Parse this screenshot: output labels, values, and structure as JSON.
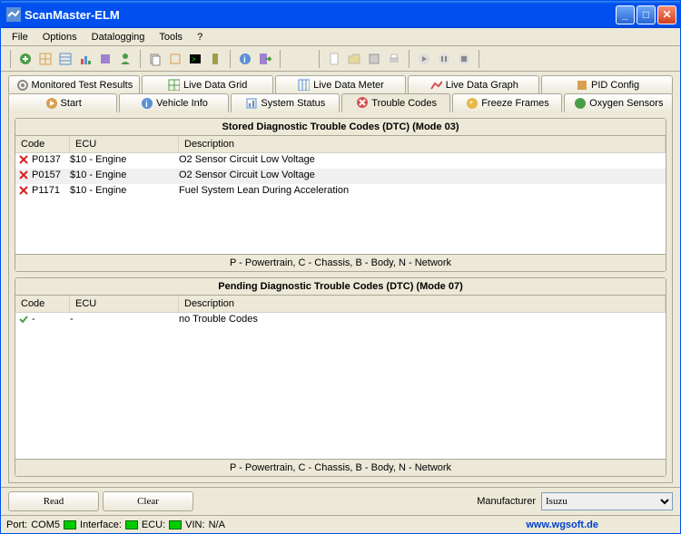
{
  "title": "ScanMaster-ELM",
  "menu": [
    "File",
    "Options",
    "Datalogging",
    "Tools",
    "?"
  ],
  "tabs_row1": [
    {
      "label": "Monitored Test Results",
      "icon": "gear"
    },
    {
      "label": "Live Data Grid",
      "icon": "grid-green"
    },
    {
      "label": "Live Data Meter",
      "icon": "meter"
    },
    {
      "label": "Live Data Graph",
      "icon": "graph"
    },
    {
      "label": "PID Config",
      "icon": "pid"
    }
  ],
  "tabs_row2": [
    {
      "label": "Start",
      "icon": "start"
    },
    {
      "label": "Vehicle Info",
      "icon": "info"
    },
    {
      "label": "System Status",
      "icon": "status"
    },
    {
      "label": "Trouble Codes",
      "icon": "error",
      "active": true
    },
    {
      "label": "Freeze Frames",
      "icon": "freeze"
    },
    {
      "label": "Oxygen Sensors",
      "icon": "o2"
    }
  ],
  "stored": {
    "title": "Stored Diagnostic Trouble Codes (DTC) (Mode 03)",
    "cols": [
      "Code",
      "ECU",
      "Description"
    ],
    "rows": [
      {
        "code": "P0137",
        "ecu": "$10 - Engine",
        "desc": "O2 Sensor Circuit Low Voltage"
      },
      {
        "code": "P0157",
        "ecu": "$10 - Engine",
        "desc": "O2 Sensor Circuit Low Voltage"
      },
      {
        "code": "P1171",
        "ecu": "$10 - Engine",
        "desc": "Fuel System Lean During Acceleration"
      }
    ],
    "footer": "P - Powertrain, C - Chassis, B - Body, N - Network"
  },
  "pending": {
    "title": "Pending Diagnostic Trouble Codes (DTC) (Mode 07)",
    "cols": [
      "Code",
      "ECU",
      "Description"
    ],
    "rows": [
      {
        "code": "-",
        "ecu": "-",
        "desc": "no Trouble Codes",
        "ok": true
      }
    ],
    "footer": "P - Powertrain, C - Chassis, B - Body, N - Network"
  },
  "buttons": {
    "read": "Read",
    "clear": "Clear"
  },
  "manufacturer": {
    "label": "Manufacturer",
    "value": "Isuzu"
  },
  "status": {
    "port_label": "Port:",
    "port": "COM5",
    "iface_label": "Interface:",
    "ecu_label": "ECU:",
    "vin_label": "VIN:",
    "vin": "N/A",
    "url": "www.wgsoft.de"
  }
}
